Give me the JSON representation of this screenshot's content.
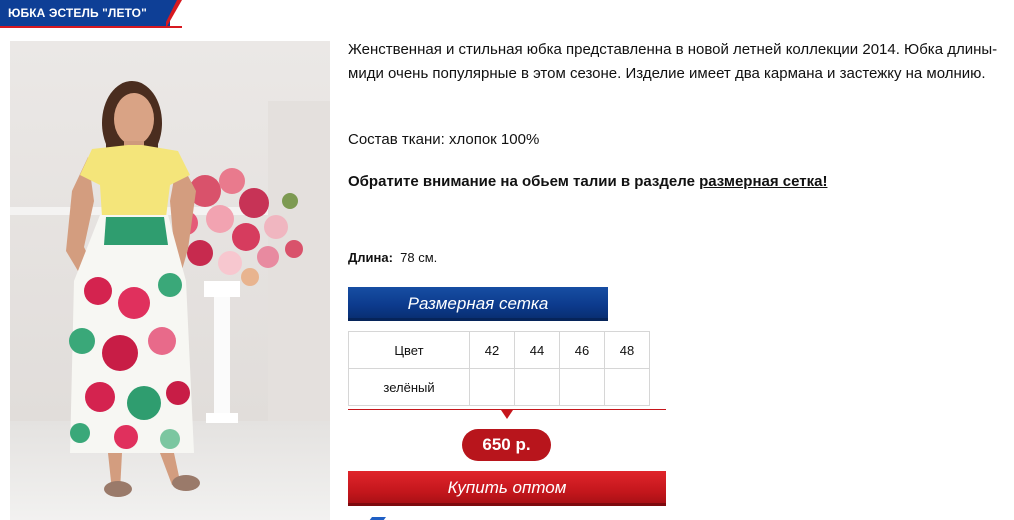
{
  "product": {
    "title": "ЮБКА ЭСТЕЛЬ \"ЛЕТО\"",
    "description": " Женственная и стильная юбка представленна в новой летней коллекции 2014. Юбка длины-миди очень популярные в этом сезоне. Изделие имеет два кармана и застежку на молнию.",
    "fabric": "Состав ткани: хлопок 100%",
    "notice_prefix": "Обратите внимание на обьем талии в разделе ",
    "notice_link": "размерная сетка!",
    "length_label": "Длина:",
    "length_value": "78 см.",
    "size_chart_button": "Размерная сетка",
    "price": "650 р.",
    "buy_button": "Купить оптом"
  },
  "size_table": {
    "header": [
      "Цвет",
      "42",
      "44",
      "46",
      "48"
    ],
    "rows": [
      {
        "color": "зелёный",
        "cells": [
          "",
          "",
          "",
          ""
        ]
      }
    ]
  },
  "colors": {
    "brand_blue": "#0e3f96",
    "accent_red": "#c6161c"
  }
}
